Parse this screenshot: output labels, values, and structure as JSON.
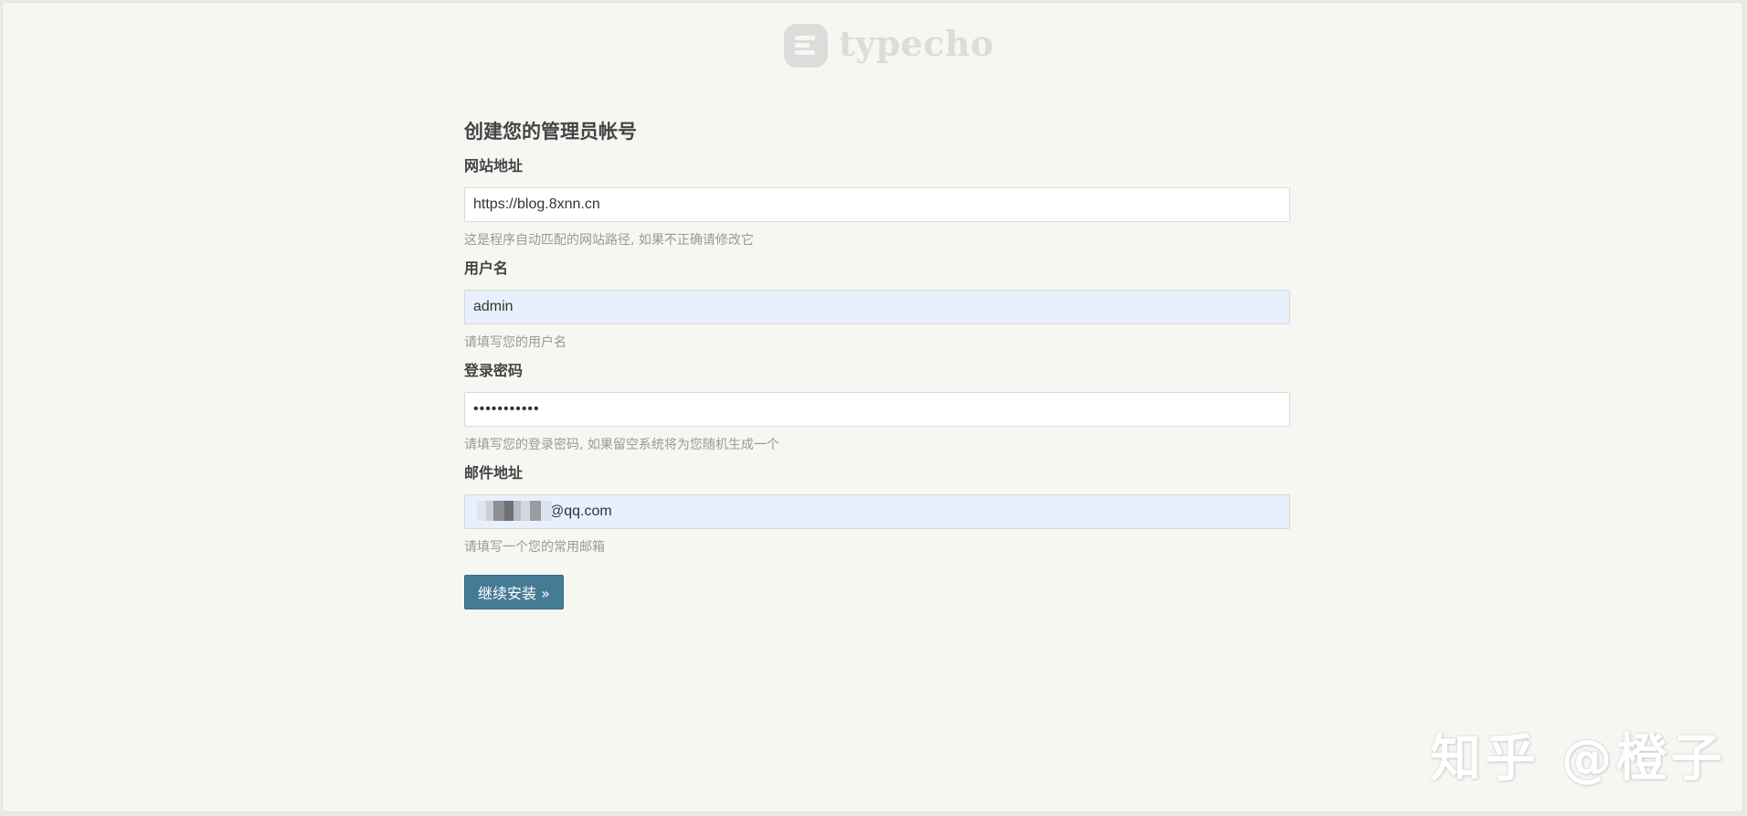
{
  "logo": {
    "text": "typecho",
    "icon": "typecho-logo-icon"
  },
  "form": {
    "heading": "创建您的管理员帐号",
    "fields": [
      {
        "label": "网站地址",
        "value": "https://blog.8xnn.cn",
        "hint": "这是程序自动匹配的网站路径, 如果不正确请修改它"
      },
      {
        "label": "用户名",
        "value": "admin",
        "hint": "请填写您的用户名"
      },
      {
        "label": "登录密码",
        "value": "•••••••••••",
        "hint": "请填写您的登录密码, 如果留空系统将为您随机生成一个"
      },
      {
        "label": "邮件地址",
        "value": "@qq.com",
        "hint": "请填写一个您的常用邮箱"
      }
    ],
    "submit_label": "继续安装 »"
  },
  "watermark": "知乎 @橙子",
  "colors": {
    "page_background": "#f6f6f3",
    "button": "#467b96",
    "autofill": "#e8f0fe"
  }
}
